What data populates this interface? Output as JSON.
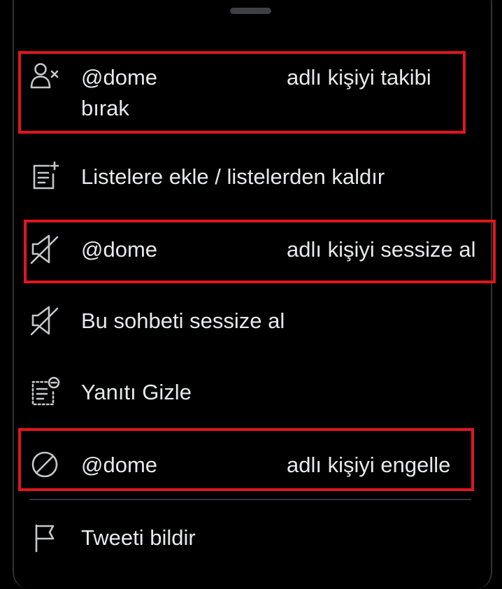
{
  "menu": {
    "unfollow": {
      "handle": "@dome",
      "text_line1": "adlı kişiyi takibi",
      "text_line2": "bırak",
      "icon": "person-x-icon"
    },
    "lists": {
      "label": "Listelere ekle / listelerden kaldır",
      "icon": "list-add-icon"
    },
    "mute_user": {
      "handle": "@dome",
      "text": "adlı kişiyi sessize al",
      "icon": "speaker-muted-icon"
    },
    "mute_conversation": {
      "label": "Bu sohbeti sessize al",
      "icon": "speaker-muted-icon"
    },
    "hide_reply": {
      "label": "Yanıtı Gizle",
      "icon": "hide-reply-icon"
    },
    "block": {
      "handle": "@dome",
      "text": "adlı kişiyi engelle",
      "icon": "block-icon"
    },
    "report": {
      "label": "Tweeti bildir",
      "icon": "flag-icon"
    }
  },
  "colors": {
    "background": "#000000",
    "text": "#e7e9ea",
    "icon": "#c4c8cc",
    "highlight": "#e0161e",
    "divider": "#2f3336"
  }
}
